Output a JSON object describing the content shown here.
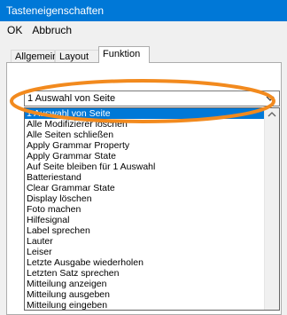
{
  "window": {
    "title": "Tasteneigenschaften"
  },
  "menu": {
    "ok_label": "OK",
    "cancel_label": "Abbruch"
  },
  "tabs": [
    {
      "label": "Allgemein"
    },
    {
      "label": "Layout"
    },
    {
      "label": "Funktion"
    }
  ],
  "combo": {
    "value": "1 Auswahl von Seite",
    "icon": "chevron-down-icon"
  },
  "list": {
    "items": [
      "1 Auswahl von Seite",
      "Alle Modifizierer löschen",
      "Alle Seiten schließen",
      "Apply Grammar Property",
      "Apply Grammar State",
      "Auf Seite bleiben für 1 Auswahl",
      "Batteriestand",
      "Clear Grammar State",
      "Display löschen",
      "Foto machen",
      "Hilfesignal",
      "Label sprechen",
      "Lauter",
      "Leiser",
      "Letzte Ausgabe wiederholen",
      "Letzten Satz sprechen",
      "Mitteilung anzeigen",
      "Mitteilung ausgeben",
      "Mitteilung eingeben"
    ],
    "selected_index": 0
  },
  "colors": {
    "accent": "#0078d7",
    "annotation": "#f28a1e"
  }
}
